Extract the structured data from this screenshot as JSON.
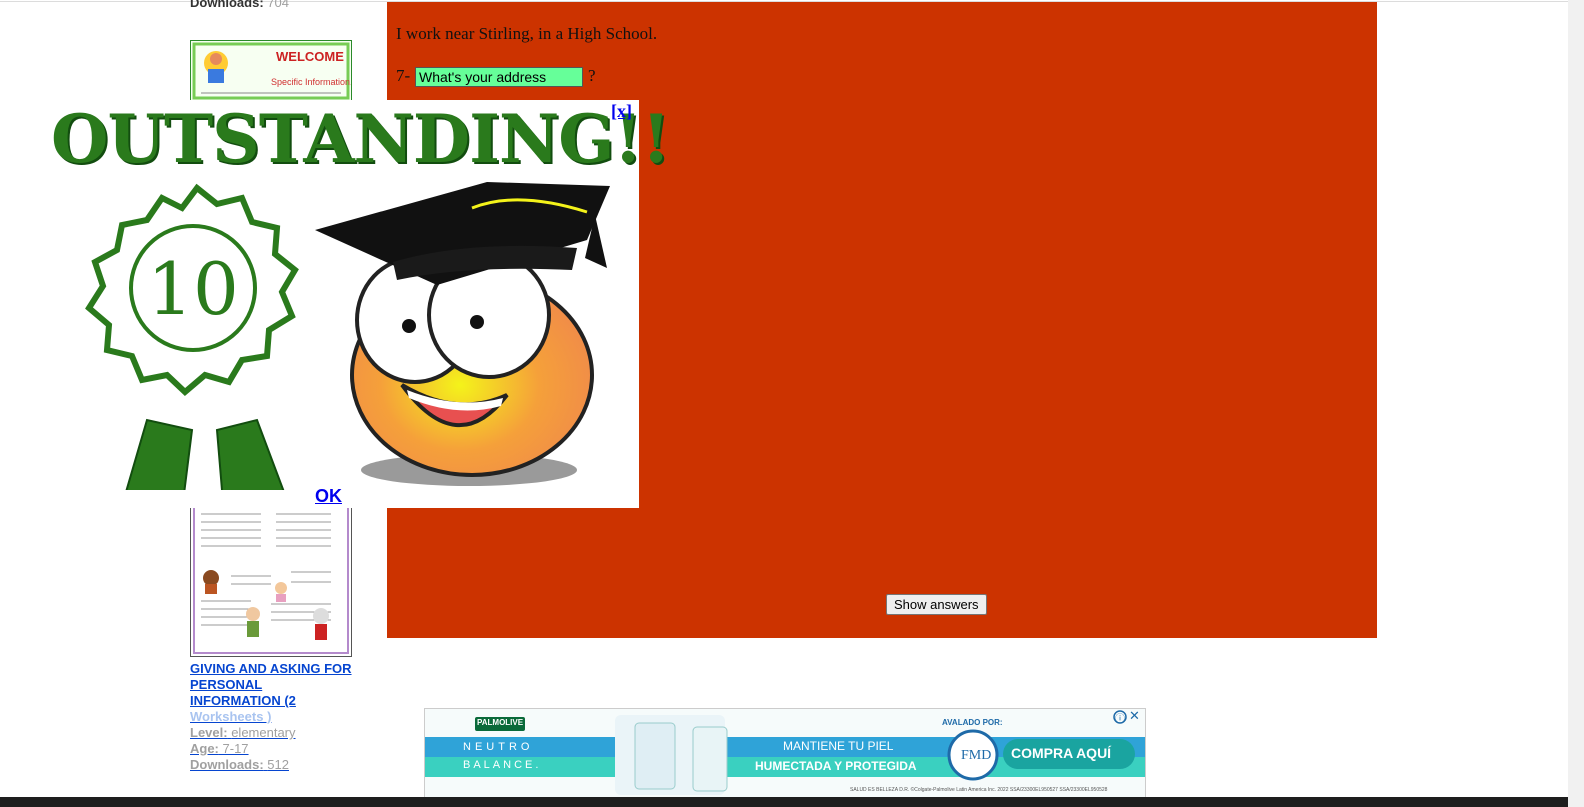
{
  "sidebar": {
    "top_downloads_label": "Downloads:",
    "top_downloads_value": "704",
    "worksheet_title_line1": "GIVING AND ASKING FOR",
    "worksheet_title_line2": "PERSONAL",
    "worksheet_title_line3": "INFORMATION (2",
    "worksheet_title_line4": "Worksheets )",
    "level_label": "Level:",
    "level_value": "elementary",
    "age_label": "Age:",
    "age_value": "7-17",
    "downloads_label": "Downloads:",
    "downloads_value": "512"
  },
  "exercise": {
    "sentence": "I work near Stirling, in a High School.",
    "question_number": "7-",
    "answer_value": "What's your address",
    "question_mark": "?",
    "show_answers_label": "Show answers"
  },
  "popup": {
    "headline": "OUTSTANDING!!",
    "badge_number": "10",
    "close_label": "[x]",
    "ok_label": "OK"
  },
  "ad": {
    "brand": "PALMOLIVE",
    "product_line1": "NEUTRO",
    "product_line2": "BALANCE.",
    "endorsed_by": "AVALADO POR:",
    "endorser": "FMD",
    "tagline_line1": "MANTIENE TU PIEL",
    "tagline_line2": "HUMECTADA Y PROTEGIDA",
    "cta": "COMPRA AQUÍ",
    "fineprint": "SALUD ES BELLEZA D.R. ©Colgate-Palmolive Latin America Inc. 2022   SSA/23300EL950527   SSA/23300EL950528"
  },
  "colors": {
    "panel_bg": "#cc3300",
    "answer_bg": "#66ff99",
    "headline_green": "#2a7a1c",
    "link_blue": "#0000ee",
    "ad_teal": "#3ad0c0"
  }
}
